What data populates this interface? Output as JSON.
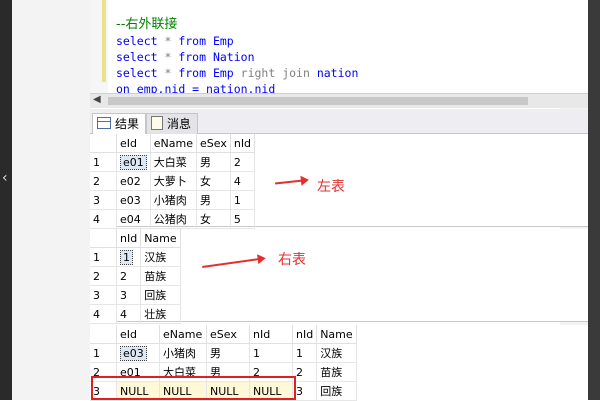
{
  "editor": {
    "lines": [
      {
        "comment": "--右外联接"
      },
      {
        "kw1": "select",
        "rest": " * ",
        "kw2": "from",
        "obj": " Emp"
      },
      {
        "kw1": "select",
        "rest": " * ",
        "kw2": "from",
        "obj": " Nation"
      },
      {
        "kw1": "select",
        "rest": " * ",
        "kw2": "from",
        "obj": " Emp ",
        "extra": "right join",
        "obj2": " nation"
      },
      {
        "kw1": "on",
        "obj": " emp.nid = nation.nid"
      }
    ]
  },
  "tabs": [
    {
      "label": "结果",
      "active": true
    },
    {
      "label": "消息",
      "active": false
    }
  ],
  "grid1": {
    "columns": [
      "eId",
      "eName",
      "eSex",
      "nId"
    ],
    "rows": [
      [
        "1",
        "e01",
        "大白菜",
        "男",
        "2"
      ],
      [
        "2",
        "e02",
        "大萝卜",
        "女",
        "4"
      ],
      [
        "3",
        "e03",
        "小猪肉",
        "男",
        "1"
      ],
      [
        "4",
        "e04",
        "公猪肉",
        "女",
        "5"
      ]
    ]
  },
  "grid2": {
    "columns": [
      "nId",
      "Name"
    ],
    "rows": [
      [
        "1",
        "1",
        "汉族"
      ],
      [
        "2",
        "2",
        "苗族"
      ],
      [
        "3",
        "3",
        "回族"
      ],
      [
        "4",
        "4",
        "壮族"
      ]
    ]
  },
  "grid3": {
    "columns": [
      "eId",
      "eName",
      "eSex",
      "nId",
      "nId",
      "Name"
    ],
    "rows": [
      [
        "1",
        "e03",
        "小猪肉",
        "男",
        "1",
        "1",
        "汉族"
      ],
      [
        "2",
        "e01",
        "大白菜",
        "男",
        "2",
        "2",
        "苗族"
      ],
      [
        "3",
        "NULL",
        "NULL",
        "NULL",
        "NULL",
        "3",
        "回族"
      ]
    ]
  },
  "annotations": {
    "left_table": "左表",
    "right_table": "右表"
  },
  "colors": {
    "annotation_red": "#e03030",
    "keyword_blue": "#0000ff",
    "comment_green": "#008000"
  }
}
